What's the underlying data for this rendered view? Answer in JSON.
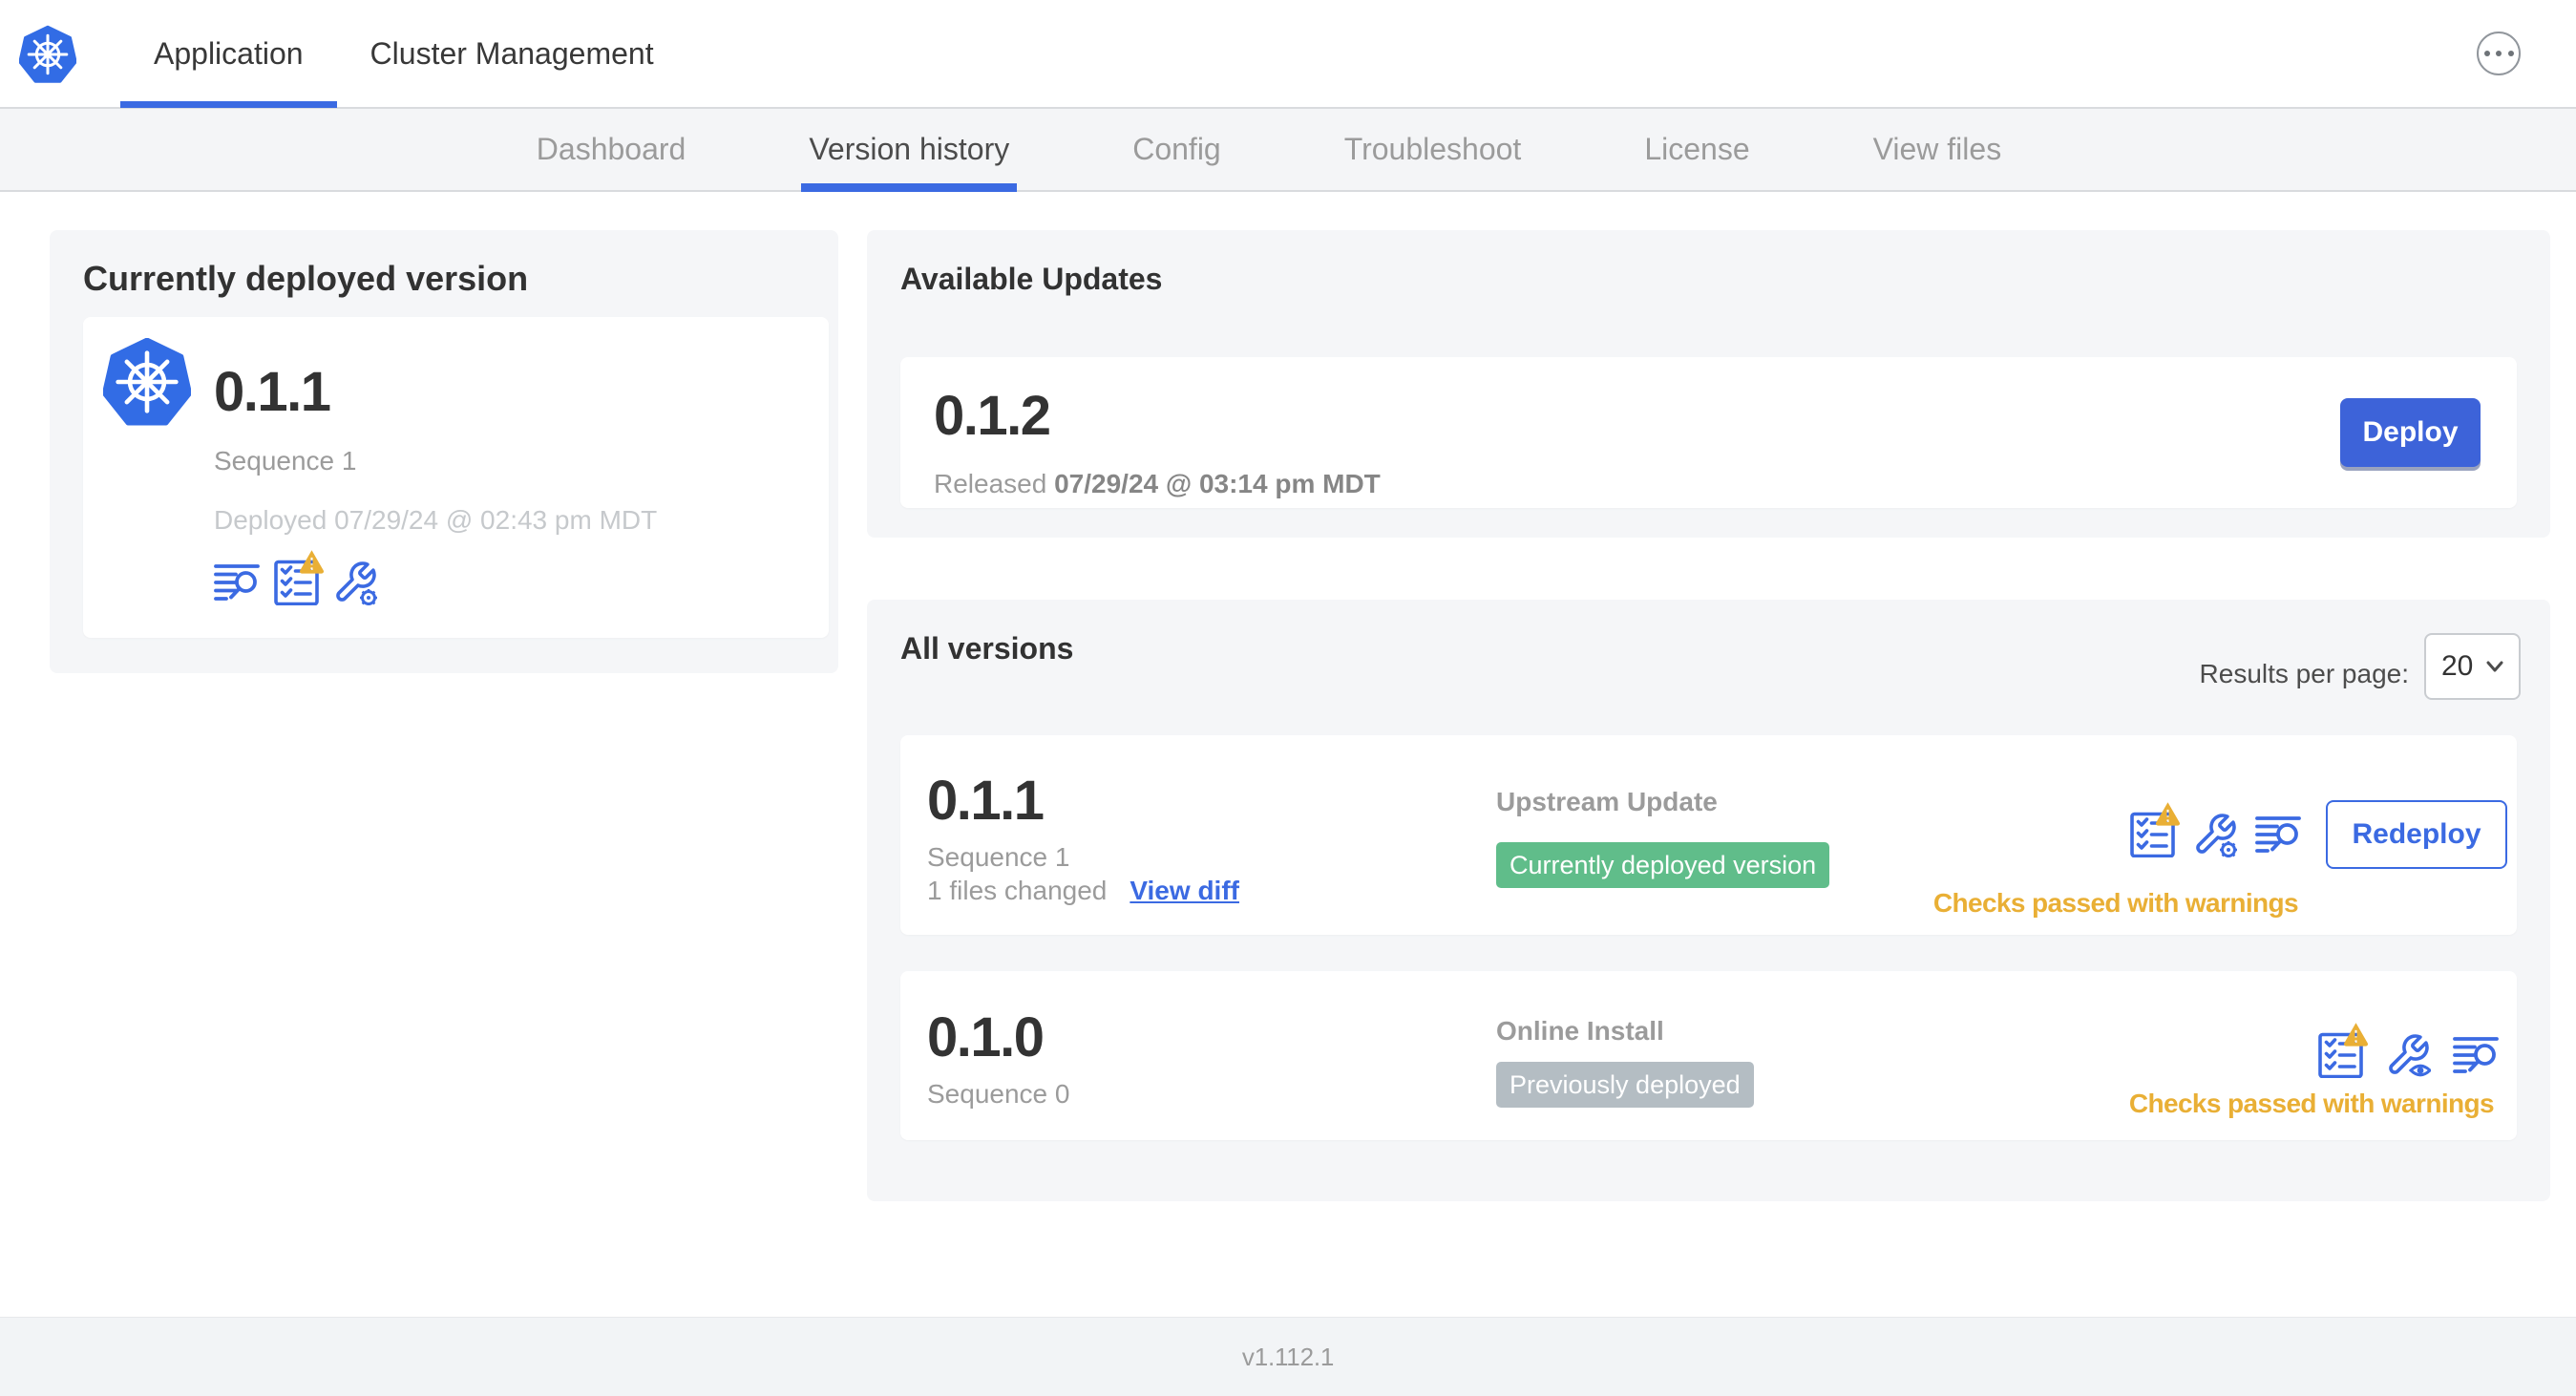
{
  "header": {
    "tabs": [
      {
        "label": "Application",
        "active": true
      },
      {
        "label": "Cluster Management",
        "active": false
      }
    ]
  },
  "subnav": {
    "tabs": [
      {
        "label": "Dashboard",
        "active": false
      },
      {
        "label": "Version history",
        "active": true
      },
      {
        "label": "Config",
        "active": false
      },
      {
        "label": "Troubleshoot",
        "active": false
      },
      {
        "label": "License",
        "active": false
      },
      {
        "label": "View files",
        "active": false
      }
    ]
  },
  "currently_deployed": {
    "title": "Currently deployed version",
    "version": "0.1.1",
    "sequence": "Sequence 1",
    "deployed": "Deployed 07/29/24 @ 02:43 pm MDT"
  },
  "available_updates": {
    "title": "Available Updates",
    "version": "0.1.2",
    "released_label": "Released",
    "released_value": "07/29/24 @ 03:14 pm MDT",
    "deploy_label": "Deploy"
  },
  "all_versions": {
    "title": "All versions",
    "results_per_page_label": "Results per page:",
    "results_per_page_value": "20",
    "rows": [
      {
        "version": "0.1.1",
        "sequence": "Sequence 1",
        "files_changed": "1 files changed",
        "view_diff_label": "View diff",
        "source": "Upstream Update",
        "badge": "Currently deployed version",
        "badge_color": "#60bd8a",
        "checks": "Checks passed with warnings",
        "action_label": "Redeploy"
      },
      {
        "version": "0.1.0",
        "sequence": "Sequence 0",
        "source": "Online Install",
        "badge": "Previously deployed",
        "badge_color": "#b4bdc3",
        "checks": "Checks passed with warnings"
      }
    ]
  },
  "footer": {
    "version": "v1.112.1"
  },
  "colors": {
    "primary_blue": "#3865dc",
    "kubernetes_blue": "#326ce5",
    "warning_amber": "#e9af35",
    "badge_green": "#60bd8a",
    "badge_gray": "#b4bdc3",
    "panel_gray": "#f5f6f8"
  }
}
